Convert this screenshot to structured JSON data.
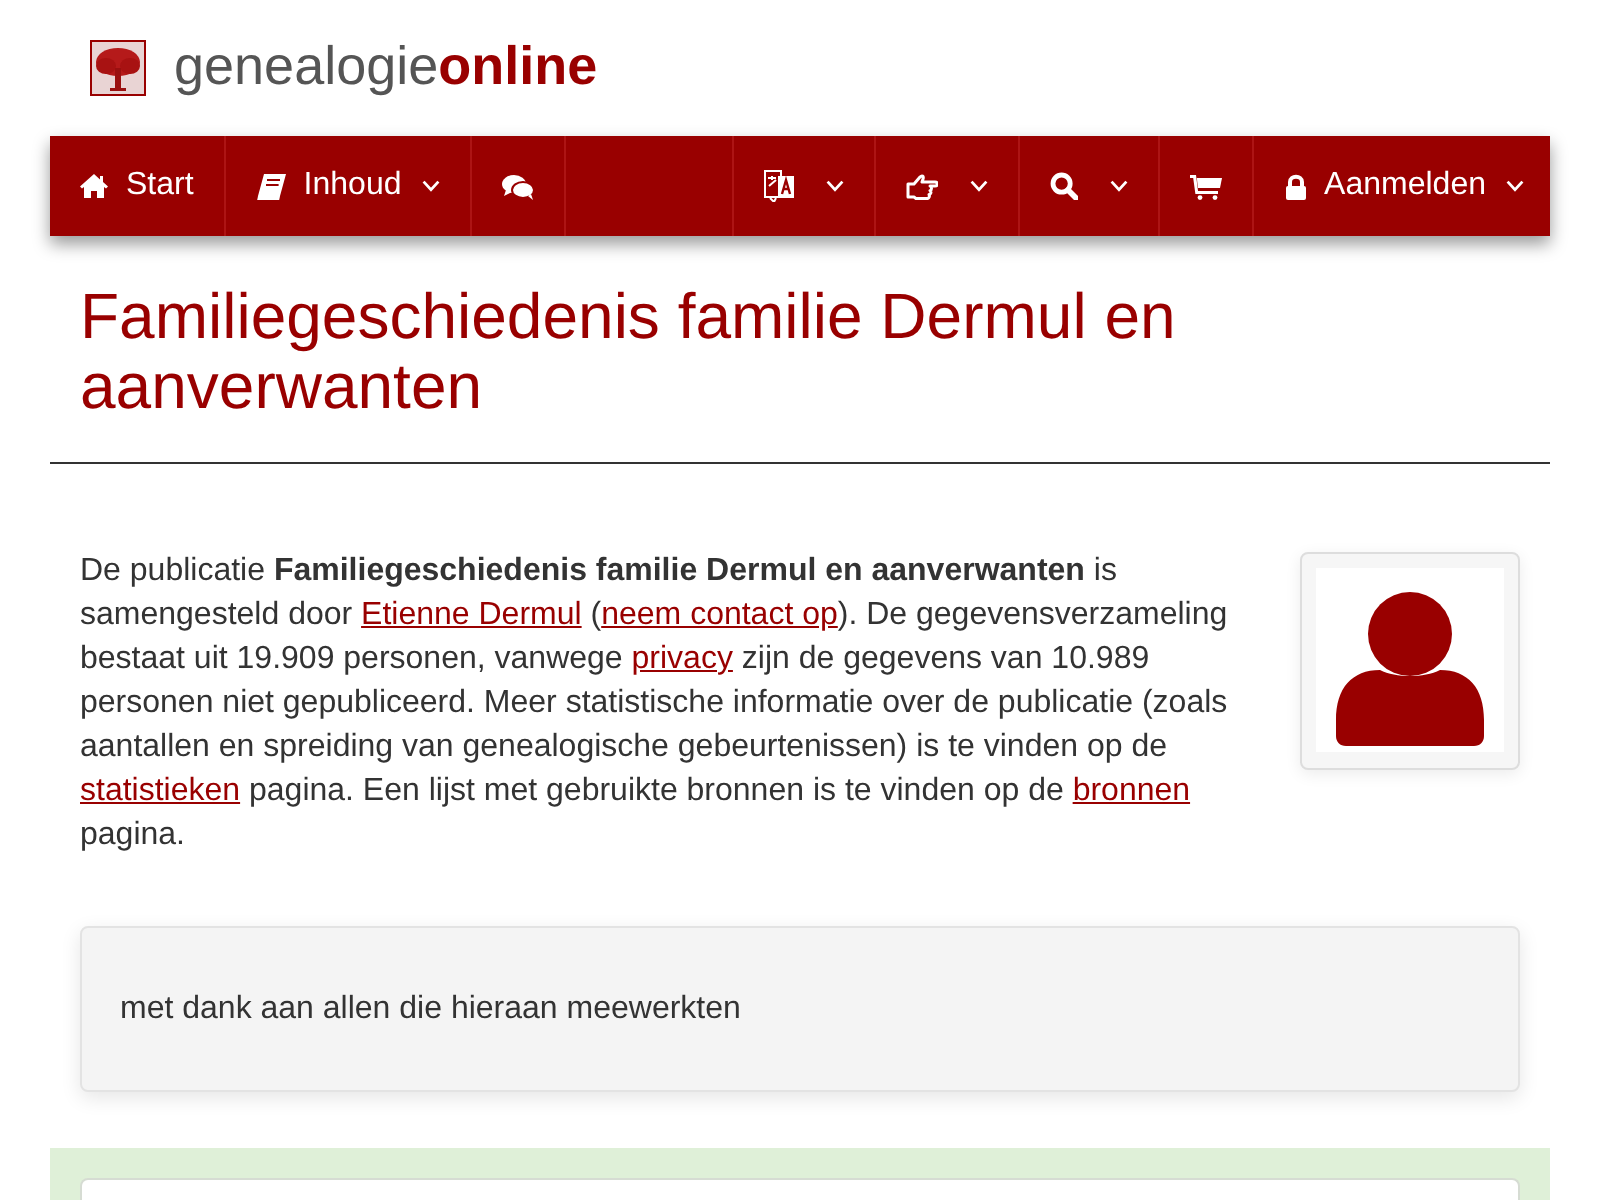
{
  "logo": {
    "name": "genealogie**online**"
  },
  "navbar": {
    "left": [
      {
        "label": "Start",
        "has_menu": false
      },
      {
        "label": "Inhoud",
        "has_menu": true
      },
      {
        "has_menu": false
      }
    ],
    "right": [
      {
        "has_menu": true
      },
      {
        "has_menu": true
      },
      {
        "has_menu": true
      },
      {
        "has_menu": false
      },
      {
        "label": "Aanmelden",
        "has_menu": true
      }
    ]
  },
  "title": "Familiegeschiedenis familie Dermul en aanverwanten",
  "intro": {
    "segments": [
      {
        "kind": "text",
        "text": "De publicatie **Familiegeschiedenis familie Dermul en aanverwanten** is samengesteld door "
      },
      {
        "kind": "link",
        "text": "Etienne Dermul"
      },
      {
        "kind": "text",
        "text": " ("
      },
      {
        "kind": "link",
        "text": "neem contact op"
      },
      {
        "kind": "text",
        "text": "). De gegevensverzameling bestaat uit 19.909 personen, vanwege "
      },
      {
        "kind": "link",
        "text": "privacy"
      },
      {
        "kind": "text",
        "text": " zijn de gegevens van 10.989 personen niet gepubliceerd. Meer statistische informatie over de publicatie (zoals aantallen en spreiding van genealogische gebeurtenissen) is te vinden op de "
      },
      {
        "kind": "link",
        "text": "statistieken"
      },
      {
        "kind": "text",
        "text": " pagina. Een lijst met gebruikte bronnen is te vinden op de "
      },
      {
        "kind": "link",
        "text": "bronnen"
      },
      {
        "kind": "text",
        "text": " pagina."
      }
    ]
  },
  "notice": {
    "text": "met dank aan allen die hieraan meewerkten"
  }
}
